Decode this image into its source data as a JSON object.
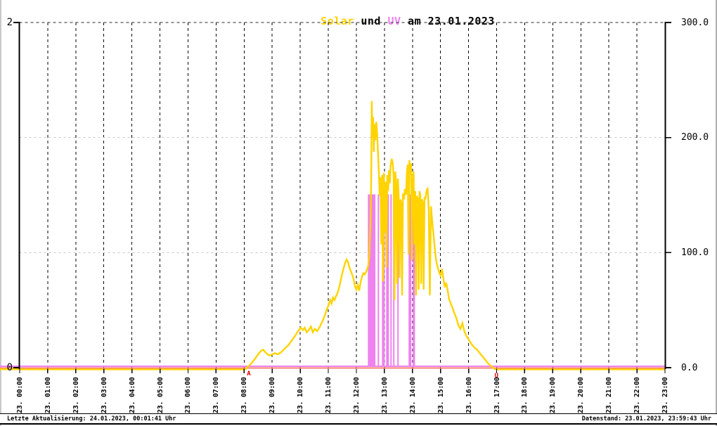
{
  "title": {
    "solar": "Solar",
    "und": " und ",
    "uv": "UV",
    "date": " am 23.01.2023"
  },
  "footer": {
    "left": "Letzte Aktualisierung: 24.01.2023, 00:01:41 Uhr",
    "right": "Datenstand: 23.01.2023, 23:59:43 Uhr"
  },
  "chart_data": {
    "type": "line",
    "title": "Solar und UV am 23.01.2023",
    "grid": true,
    "baseline_color": "#fa8072",
    "x_axis": {
      "tick_labels": [
        "23. 00:00",
        "23. 01:00",
        "23. 02:00",
        "23. 03:00",
        "23. 04:00",
        "23. 05:00",
        "23. 06:00",
        "23. 07:00",
        "23. 08:00",
        "23. 09:00",
        "23. 10:00",
        "23. 11:00",
        "23. 12:00",
        "23. 13:00",
        "23. 14:00",
        "23. 15:00",
        "23. 16:00",
        "23. 17:00",
        "23. 18:00",
        "23. 19:00",
        "23. 20:00",
        "23. 21:00",
        "23. 22:00",
        "23. 23:00"
      ]
    },
    "left_axis": {
      "min": 0,
      "max": 2,
      "tick_labels": [
        "2",
        "0"
      ],
      "tick_values": [
        2,
        0
      ]
    },
    "right_axis": {
      "min": 0,
      "max": 300,
      "tick_labels": [
        "300.0",
        "200.0",
        "100.0",
        "0.0"
      ],
      "tick_values": [
        300,
        200,
        100,
        0
      ]
    },
    "markers": [
      {
        "label": "A",
        "time": 8.05,
        "color": "#dd0000"
      },
      {
        "label": "U",
        "time": 16.95,
        "color": "#dd0000"
      }
    ],
    "series": [
      {
        "name": "Solar",
        "axis": "right",
        "color": "#ffd300",
        "points": [
          [
            0,
            0
          ],
          [
            8.05,
            0
          ],
          [
            8.12,
            2
          ],
          [
            8.25,
            5
          ],
          [
            8.38,
            9
          ],
          [
            8.5,
            13
          ],
          [
            8.6,
            16
          ],
          [
            8.68,
            17
          ],
          [
            8.75,
            15
          ],
          [
            8.83,
            13
          ],
          [
            8.92,
            12
          ],
          [
            9.0,
            13
          ],
          [
            9.1,
            14
          ],
          [
            9.2,
            13
          ],
          [
            9.33,
            15
          ],
          [
            9.45,
            18
          ],
          [
            9.58,
            21
          ],
          [
            9.7,
            25
          ],
          [
            9.82,
            29
          ],
          [
            9.92,
            33
          ],
          [
            10.02,
            36
          ],
          [
            10.1,
            34
          ],
          [
            10.16,
            36
          ],
          [
            10.23,
            32
          ],
          [
            10.3,
            34
          ],
          [
            10.38,
            37
          ],
          [
            10.45,
            32
          ],
          [
            10.52,
            35
          ],
          [
            10.6,
            33
          ],
          [
            10.7,
            37
          ],
          [
            10.8,
            42
          ],
          [
            10.88,
            47
          ],
          [
            10.95,
            52
          ],
          [
            11.02,
            56
          ],
          [
            11.07,
            60
          ],
          [
            11.12,
            57
          ],
          [
            11.17,
            62
          ],
          [
            11.22,
            60
          ],
          [
            11.27,
            63
          ],
          [
            11.33,
            66
          ],
          [
            11.4,
            72
          ],
          [
            11.47,
            80
          ],
          [
            11.53,
            86
          ],
          [
            11.6,
            92
          ],
          [
            11.65,
            95
          ],
          [
            11.7,
            93
          ],
          [
            11.75,
            88
          ],
          [
            11.8,
            85
          ],
          [
            11.85,
            82
          ],
          [
            11.9,
            78
          ],
          [
            11.95,
            72
          ],
          [
            12.0,
            69
          ],
          [
            12.05,
            73
          ],
          [
            12.1,
            68
          ],
          [
            12.15,
            75
          ],
          [
            12.2,
            80
          ],
          [
            12.25,
            83
          ],
          [
            12.3,
            82
          ],
          [
            12.36,
            85
          ],
          [
            12.42,
            89
          ],
          [
            12.46,
            98
          ],
          [
            12.5,
            125
          ],
          [
            12.53,
            165
          ],
          [
            12.55,
            232
          ],
          [
            12.57,
            200
          ],
          [
            12.6,
            218
          ],
          [
            12.62,
            188
          ],
          [
            12.65,
            212
          ],
          [
            12.68,
            198
          ],
          [
            12.71,
            214
          ],
          [
            12.74,
            204
          ],
          [
            12.77,
            188
          ],
          [
            12.8,
            171
          ],
          [
            12.83,
            150
          ],
          [
            12.86,
            166
          ],
          [
            12.89,
            108
          ],
          [
            12.92,
            168
          ],
          [
            12.95,
            76
          ],
          [
            12.98,
            170
          ],
          [
            13.01,
            118
          ],
          [
            13.04,
            162
          ],
          [
            13.07,
            88
          ],
          [
            13.1,
            168
          ],
          [
            13.13,
            154
          ],
          [
            13.16,
            172
          ],
          [
            13.19,
            161
          ],
          [
            13.22,
            176
          ],
          [
            13.26,
            182
          ],
          [
            13.3,
            178
          ],
          [
            13.33,
            167
          ],
          [
            13.36,
            60
          ],
          [
            13.39,
            171
          ],
          [
            13.42,
            159
          ],
          [
            13.45,
            74
          ],
          [
            13.48,
            165
          ],
          [
            13.51,
            149
          ],
          [
            13.54,
            79
          ],
          [
            13.57,
            147
          ],
          [
            13.6,
            144
          ],
          [
            13.63,
            64
          ],
          [
            13.66,
            152
          ],
          [
            13.7,
            147
          ],
          [
            13.73,
            156
          ],
          [
            13.77,
            151
          ],
          [
            13.8,
            170
          ],
          [
            13.83,
            177
          ],
          [
            13.86,
            99
          ],
          [
            13.89,
            181
          ],
          [
            13.92,
            169
          ],
          [
            13.95,
            178
          ],
          [
            13.98,
            94
          ],
          [
            14.01,
            164
          ],
          [
            14.04,
            171
          ],
          [
            14.07,
            108
          ],
          [
            14.1,
            154
          ],
          [
            14.13,
            64
          ],
          [
            14.16,
            150
          ],
          [
            14.19,
            147
          ],
          [
            14.22,
            69
          ],
          [
            14.25,
            154
          ],
          [
            14.28,
            151
          ],
          [
            14.31,
            74
          ],
          [
            14.34,
            147
          ],
          [
            14.37,
            144
          ],
          [
            14.4,
            69
          ],
          [
            14.43,
            149
          ],
          [
            14.46,
            147
          ],
          [
            14.5,
            154
          ],
          [
            14.54,
            157
          ],
          [
            14.58,
            139
          ],
          [
            14.62,
            64
          ],
          [
            14.66,
            141
          ],
          [
            14.7,
            129
          ],
          [
            14.74,
            119
          ],
          [
            14.78,
            109
          ],
          [
            14.82,
            99
          ],
          [
            14.86,
            92
          ],
          [
            14.9,
            88
          ],
          [
            14.95,
            84
          ],
          [
            15.0,
            81
          ],
          [
            15.05,
            87
          ],
          [
            15.1,
            79
          ],
          [
            15.15,
            71
          ],
          [
            15.2,
            75
          ],
          [
            15.25,
            69
          ],
          [
            15.3,
            61
          ],
          [
            15.36,
            57
          ],
          [
            15.43,
            53
          ],
          [
            15.5,
            48
          ],
          [
            15.57,
            44
          ],
          [
            15.64,
            38
          ],
          [
            15.71,
            35
          ],
          [
            15.78,
            40
          ],
          [
            15.85,
            33
          ],
          [
            15.92,
            29
          ],
          [
            16.0,
            26
          ],
          [
            16.1,
            22
          ],
          [
            16.2,
            19
          ],
          [
            16.3,
            17
          ],
          [
            16.4,
            14
          ],
          [
            16.5,
            11
          ],
          [
            16.6,
            8
          ],
          [
            16.7,
            5
          ],
          [
            16.8,
            3
          ],
          [
            16.9,
            1
          ],
          [
            16.95,
            0
          ],
          [
            23.0,
            0
          ]
        ]
      },
      {
        "name": "UV",
        "axis": "left",
        "color": "#ee82ee",
        "bars": [
          {
            "start": 12.41,
            "end": 12.68,
            "value": 1
          },
          {
            "start": 12.76,
            "end": 12.81,
            "value": 1
          },
          {
            "start": 12.91,
            "end": 13.01,
            "value": 1
          },
          {
            "start": 13.06,
            "end": 13.16,
            "value": 1
          },
          {
            "start": 13.21,
            "end": 13.26,
            "value": 1
          },
          {
            "start": 13.31,
            "end": 13.36,
            "value": 1
          },
          {
            "start": 13.46,
            "end": 13.49,
            "value": 1
          },
          {
            "start": 13.86,
            "end": 13.96,
            "value": 1
          },
          {
            "start": 14.01,
            "end": 14.09,
            "value": 1
          }
        ]
      }
    ]
  }
}
